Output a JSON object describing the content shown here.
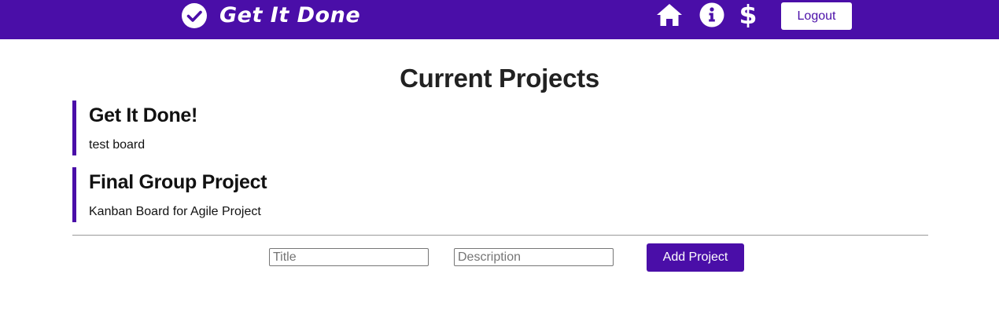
{
  "header": {
    "brand": {
      "icon": "check-circle-icon",
      "title": "Get It Done"
    },
    "nav_icons": [
      "home-icon",
      "info-icon",
      "dollar-icon"
    ],
    "dollar_glyph": "$",
    "logout_label": "Logout"
  },
  "main": {
    "page_title": "Current Projects",
    "projects": [
      {
        "title": "Get It Done!",
        "description": "test board"
      },
      {
        "title": "Final Group Project",
        "description": "Kanban Board for Agile Project"
      }
    ]
  },
  "add_form": {
    "title_placeholder": "Title",
    "description_placeholder": "Description",
    "title_value": "",
    "description_value": "",
    "submit_label": "Add Project"
  },
  "colors": {
    "accent": "#4a0ea8",
    "text": "#111111",
    "background": "#ffffff"
  }
}
